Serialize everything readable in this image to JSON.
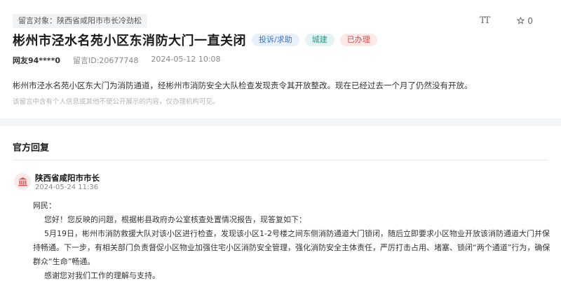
{
  "message": {
    "target_label": "留言对象：陕西省咸阳市市长冷劲松",
    "title": "彬州市泾水名苑小区东消防大门一直关闭",
    "tags": [
      "投诉/求助",
      "城建",
      "已办理"
    ],
    "user": "网友94****0",
    "message_id": "留言ID:20677748",
    "datetime": "2024-05-12 10:08",
    "content": "彬州市泾水名苑小区东大门为消防通道，经彬州市消防安全大队检查发现责令其开放整改。现在已经过去一个月了仍然没有开放。",
    "privacy_notice": "该留言中含有个人信息或其他不便公开展示的内容，仅办理机构可见。"
  },
  "toolbar": {
    "font_size_icon": "TT",
    "star_count": "0"
  },
  "official_reply": {
    "section_title": "官方回复",
    "org": "陕西省咸阳市市长",
    "date": "2024-05-24 11:36",
    "salutation": "网民：",
    "paragraphs": [
      "您好！您反映的问题，根据彬县政府办公室核查处置情况报告，现答复如下：",
      "5月19日，彬州市消防救援大队对该小区进行检查，发现该小区1-2号楼之间东侧消防通道大门锁闭，随后立即要求小区物业开放该消防通道大门并保持畅通。下一步，有相关部门负责督促小区物业加强住宅小区消防安全管理，强化消防安全主体责任，严厉打击占用、堵塞、锁闭“两个通道”行为，确保群众“生命”畅通。",
      "感谢您对我们工作的理解与支持。"
    ]
  },
  "colors": {
    "tag_blue": "#3b73c8",
    "tag_teal": "#2f9487",
    "tag_red": "#e04848"
  }
}
